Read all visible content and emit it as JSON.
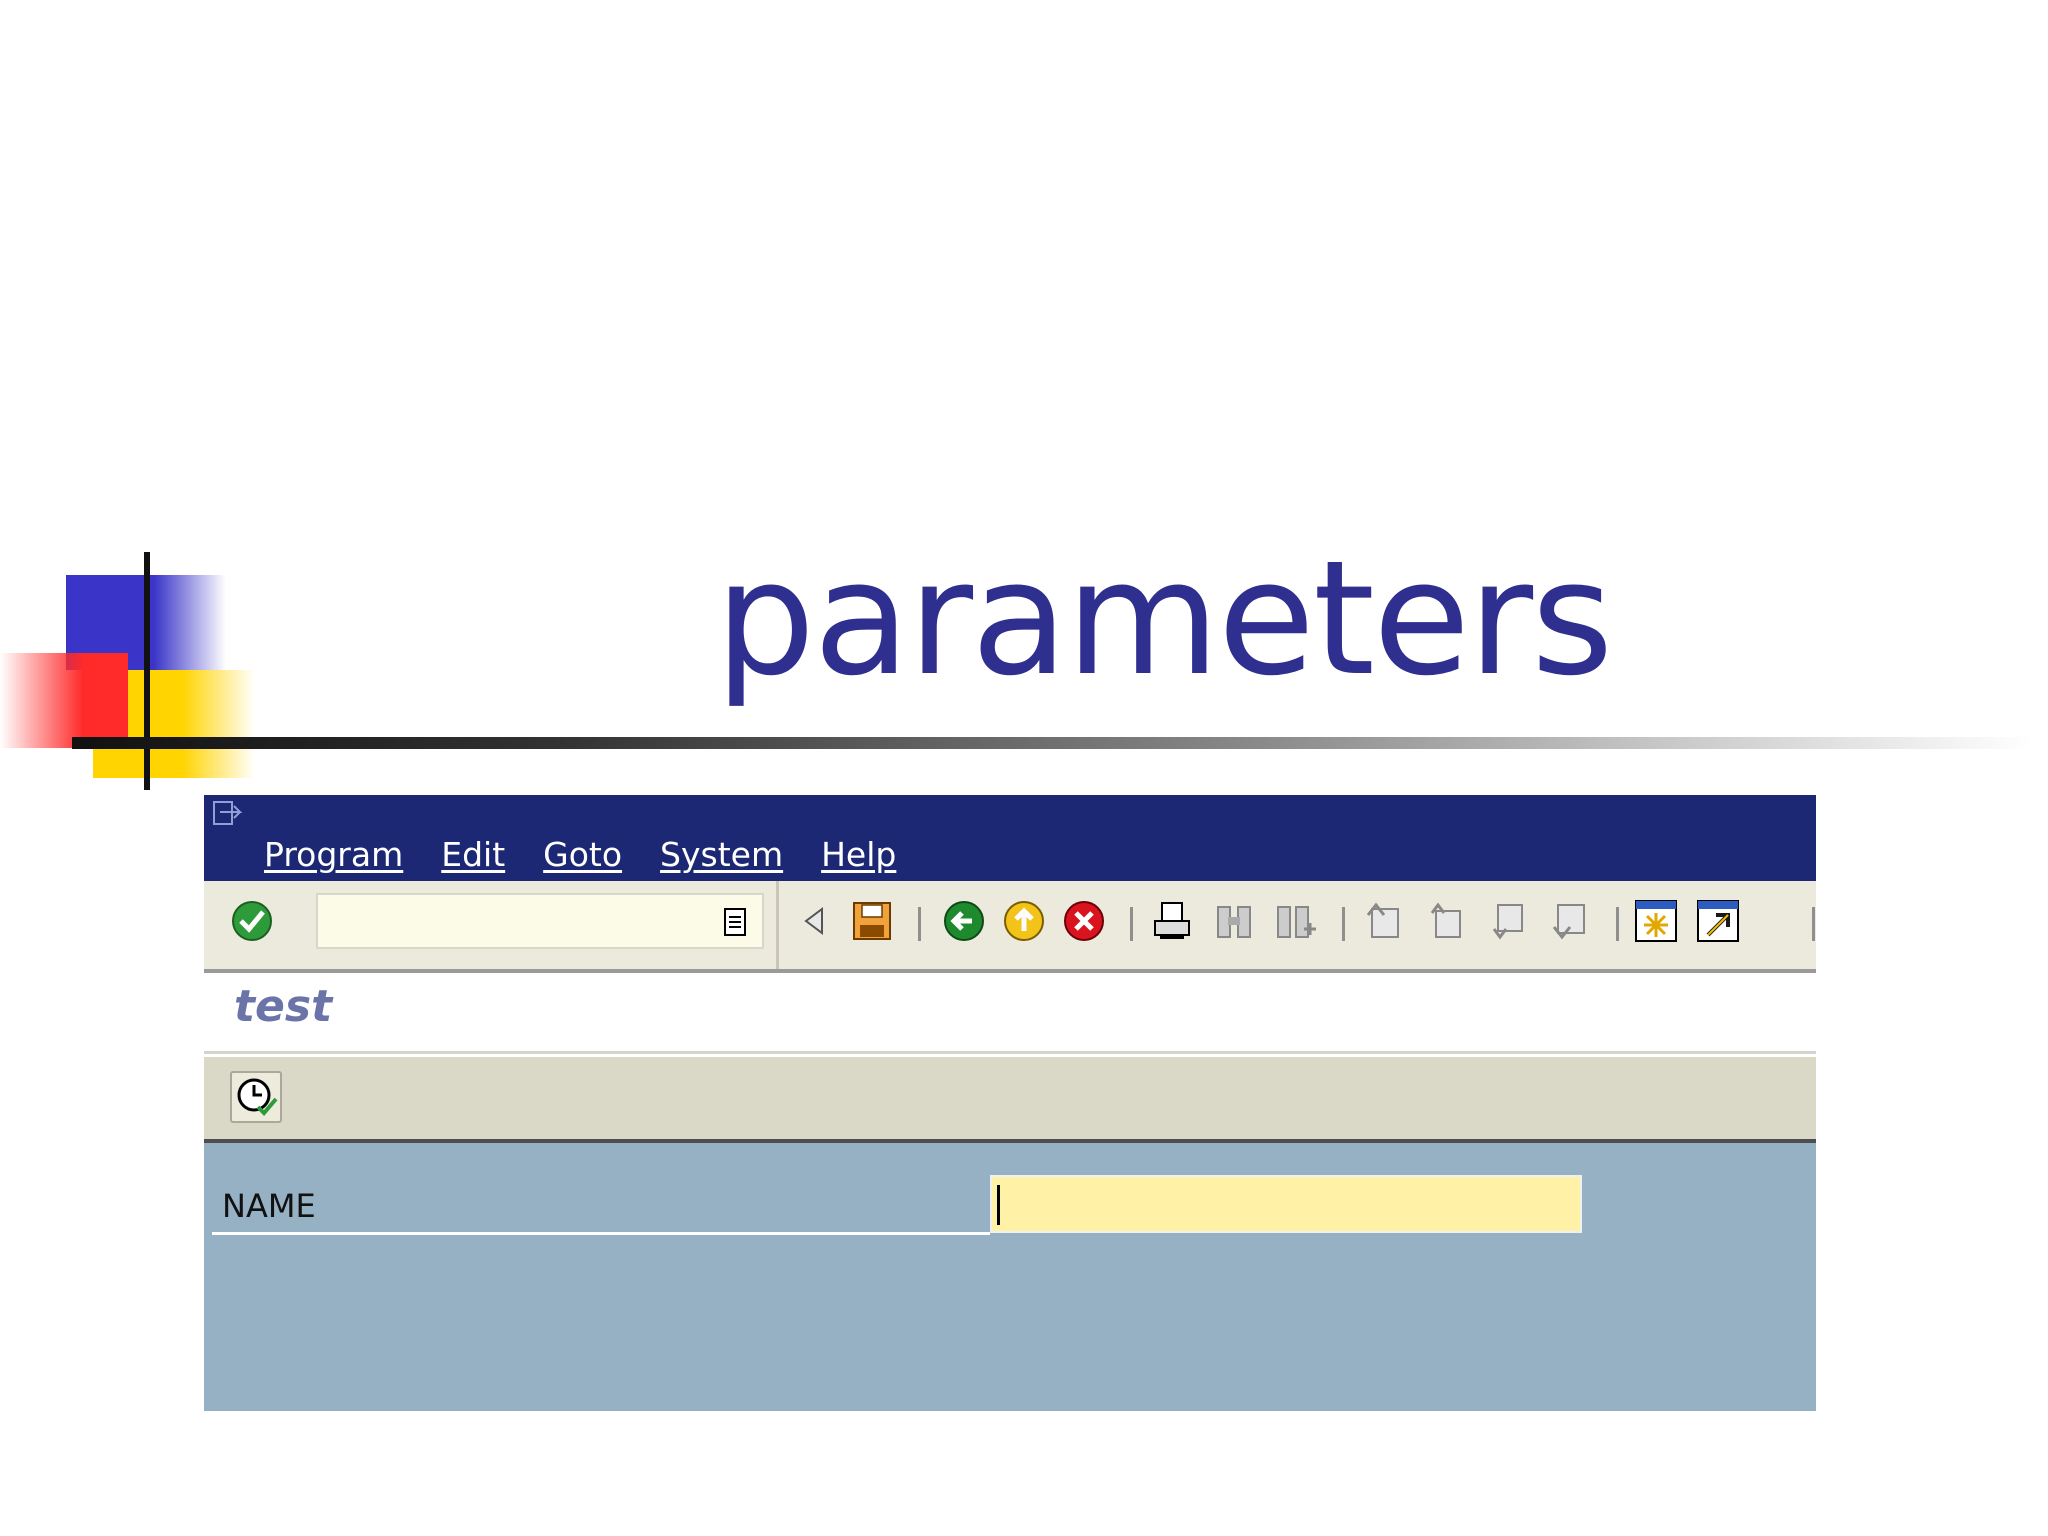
{
  "slide": {
    "title": "parameters"
  },
  "window": {
    "menu": [
      "Program",
      "Edit",
      "Goto",
      "System",
      "Help"
    ],
    "command_field": {
      "value": "",
      "placeholder": ""
    },
    "toolbar_icons": [
      "enter-check-icon",
      "command-history-icon",
      "back-arrow-icon",
      "save-icon",
      "back-icon",
      "exit-icon",
      "cancel-icon",
      "print-icon",
      "find-icon",
      "find-next-icon",
      "first-page-icon",
      "previous-page-icon",
      "next-page-icon",
      "last-page-icon",
      "create-session-icon",
      "shortcut-icon"
    ],
    "app_title": "test",
    "app_toolbar": {
      "execute_icon": "execute-clock-icon"
    },
    "selection": {
      "label": "NAME",
      "value": ""
    }
  },
  "colors": {
    "title_text": "#2f2f8f",
    "titlebar": "#1c2874",
    "toolbar": "#ece9dd",
    "selection_bg": "#96b1c4",
    "input_bg": "#fff1a6"
  }
}
